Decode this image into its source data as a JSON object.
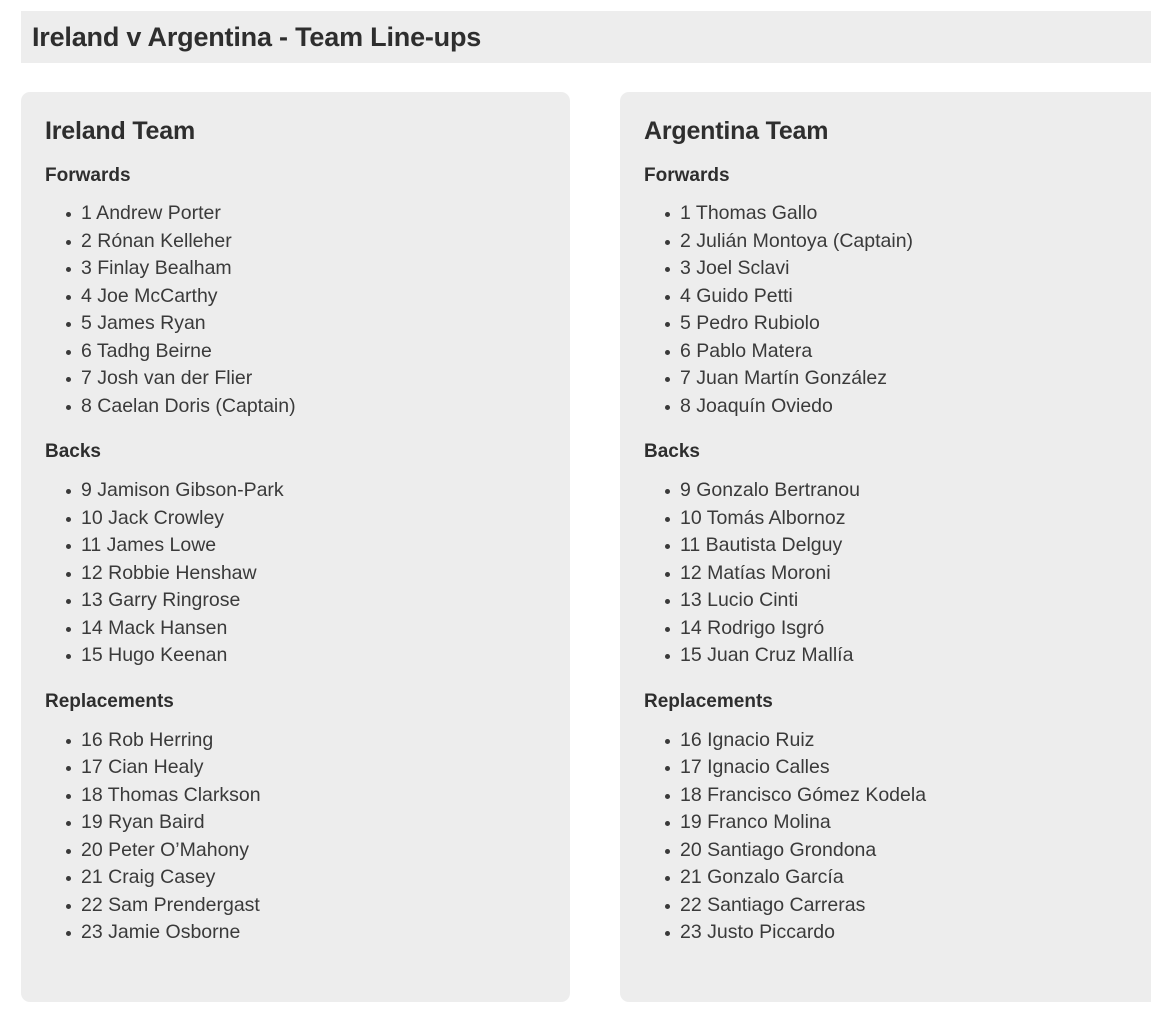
{
  "header": {
    "title": "Ireland v Argentina - Team Line-ups"
  },
  "theme": {
    "page_background": "#ffffff",
    "panel_background": "#ededed",
    "heading_color": "#2e2e2e",
    "text_color": "#3a3a3a"
  },
  "teams": [
    {
      "name": "Ireland Team",
      "groups": [
        {
          "heading": "Forwards",
          "players": [
            "1 Andrew Porter",
            "2 Rónan Kelleher",
            "3 Finlay Bealham",
            "4 Joe McCarthy",
            "5 James Ryan",
            "6 Tadhg Beirne",
            "7 Josh van der Flier",
            "8 Caelan Doris (Captain)"
          ]
        },
        {
          "heading": "Backs",
          "players": [
            "9 Jamison Gibson-Park",
            "10 Jack Crowley",
            "11 James Lowe",
            "12 Robbie Henshaw",
            "13 Garry Ringrose",
            "14 Mack Hansen",
            "15 Hugo Keenan"
          ]
        },
        {
          "heading": "Replacements",
          "players": [
            "16 Rob Herring",
            "17 Cian Healy",
            "18 Thomas Clarkson",
            "19 Ryan Baird",
            "20 Peter O’Mahony",
            "21 Craig Casey",
            "22 Sam Prendergast",
            "23 Jamie Osborne"
          ]
        }
      ]
    },
    {
      "name": "Argentina Team",
      "groups": [
        {
          "heading": "Forwards",
          "players": [
            "1 Thomas Gallo",
            "2 Julián Montoya (Captain)",
            "3 Joel Sclavi",
            "4 Guido Petti",
            "5 Pedro Rubiolo",
            "6 Pablo Matera",
            "7 Juan Martín González",
            "8 Joaquín Oviedo"
          ]
        },
        {
          "heading": "Backs",
          "players": [
            "9 Gonzalo Bertranou",
            "10 Tomás Albornoz",
            "11 Bautista Delguy",
            "12 Matías Moroni",
            "13 Lucio Cinti",
            "14 Rodrigo Isgró",
            "15 Juan Cruz Mallía"
          ]
        },
        {
          "heading": "Replacements",
          "players": [
            "16 Ignacio Ruiz",
            "17 Ignacio Calles",
            "18 Francisco Gómez Kodela",
            "19 Franco Molina",
            "20 Santiago Grondona",
            "21 Gonzalo García",
            "22 Santiago Carreras",
            "23 Justo Piccardo"
          ]
        }
      ]
    }
  ]
}
